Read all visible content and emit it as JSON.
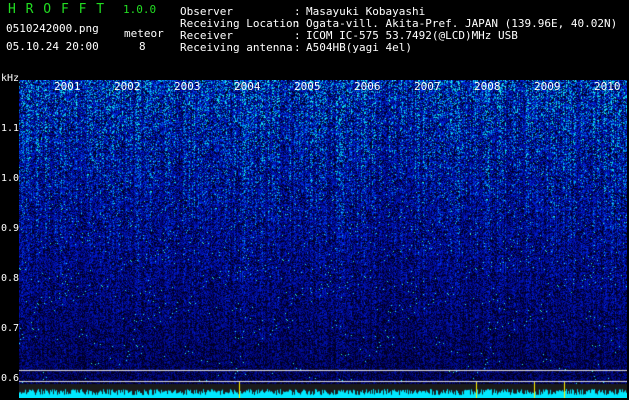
{
  "header": {
    "app_title": "H R O F F T",
    "version": "1.0.0",
    "filename": "0510242000.png",
    "datetime": "05.10.24 20:00",
    "meteor_label": "meteor",
    "meteor_count": "8"
  },
  "station": {
    "observer_label": "Observer",
    "observer_value": "Masayuki Kobayashi",
    "location_label": "Receiving Location",
    "location_value": "Ogata-vill. Akita-Pref. JAPAN (139.96E, 40.02N)",
    "receiver_label": "Receiver",
    "receiver_value": "ICOM IC-575 53.7492(@LCD)MHz USB",
    "antenna_label": "Receiving antenna",
    "antenna_value": "A504HB(yagi 4el)",
    "sep": ":"
  },
  "axis": {
    "unit": "kHz",
    "y_ticks": [
      "1.1",
      "1.0",
      "0.9",
      "0.8",
      "0.7",
      "0.6"
    ],
    "x_ticks": [
      "2001",
      "2002",
      "2003",
      "2004",
      "2005",
      "2006",
      "2007",
      "2008",
      "2009",
      "2010"
    ]
  },
  "colors": {
    "background": "#000000",
    "title": "#22dd22",
    "text": "#ffffff",
    "noise_low": "#0b1d9a",
    "noise_high": "#00f0ff"
  }
}
